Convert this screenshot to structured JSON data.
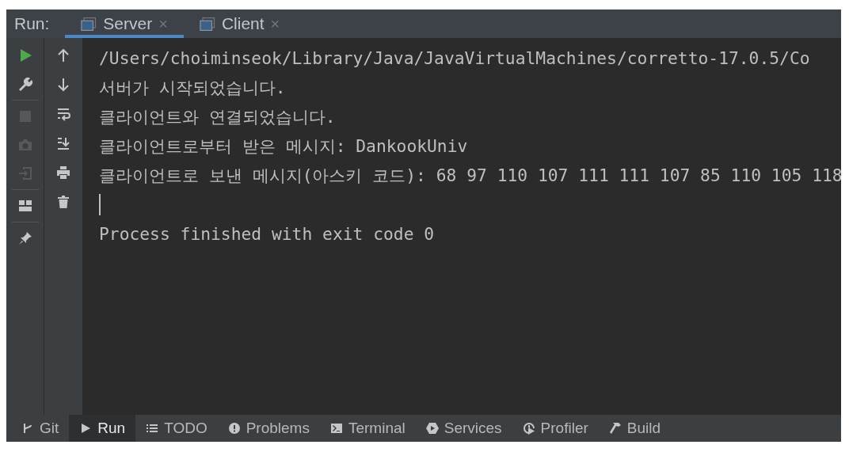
{
  "run_label": "Run:",
  "tabs": [
    {
      "label": "Server",
      "selected": true,
      "close": "×"
    },
    {
      "label": "Client",
      "selected": false,
      "close": "×"
    }
  ],
  "toolbar_left": [
    {
      "kind": "run",
      "disabled": false
    },
    {
      "kind": "wrench",
      "disabled": false
    },
    {
      "kind": "sep"
    },
    {
      "kind": "stop",
      "disabled": true
    },
    {
      "kind": "camera",
      "disabled": true
    },
    {
      "kind": "exit",
      "disabled": true
    },
    {
      "kind": "sep"
    },
    {
      "kind": "layout",
      "disabled": false
    },
    {
      "kind": "sep"
    },
    {
      "kind": "pin",
      "disabled": false
    }
  ],
  "toolbar_right": [
    {
      "kind": "up",
      "disabled": false
    },
    {
      "kind": "down",
      "disabled": false
    },
    {
      "kind": "wrap",
      "disabled": false
    },
    {
      "kind": "scroll-end",
      "disabled": false
    },
    {
      "kind": "print",
      "disabled": false
    },
    {
      "kind": "trash",
      "disabled": false
    }
  ],
  "console_lines": [
    {
      "kind": "text",
      "text": "/Users/choiminseok/Library/Java/JavaVirtualMachines/corretto-17.0.5/Co"
    },
    {
      "kind": "text",
      "text": "서버가 시작되었습니다."
    },
    {
      "kind": "text",
      "text": "클라이언트와 연결되었습니다."
    },
    {
      "kind": "text",
      "text": "클라이언트로부터 받은 메시지: DankookUniv"
    },
    {
      "kind": "text",
      "text": "클라이언트로 보낸 메시지(아스키 코드): 68 97 110 107 111 111 107 85 110 105 118"
    },
    {
      "kind": "cursor"
    },
    {
      "kind": "text",
      "text": "Process finished with exit code 0"
    }
  ],
  "bottom_bar": [
    {
      "kind": "git",
      "label": "Git",
      "selected": false
    },
    {
      "kind": "run",
      "label": "Run",
      "selected": true
    },
    {
      "kind": "todo",
      "label": "TODO",
      "selected": false
    },
    {
      "kind": "problems",
      "label": "Problems",
      "selected": false
    },
    {
      "kind": "terminal",
      "label": "Terminal",
      "selected": false
    },
    {
      "kind": "services",
      "label": "Services",
      "selected": false
    },
    {
      "kind": "profiler",
      "label": "Profiler",
      "selected": false
    },
    {
      "kind": "build",
      "label": "Build",
      "selected": false
    }
  ]
}
